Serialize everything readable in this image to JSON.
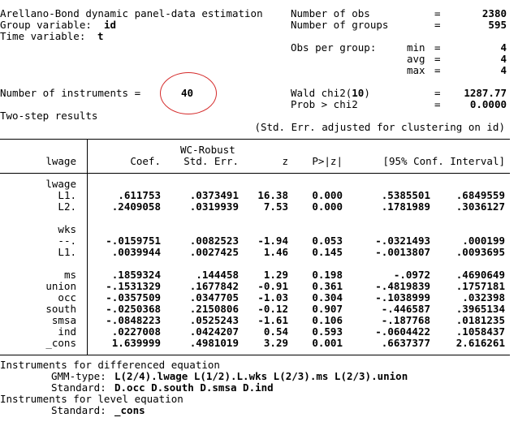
{
  "header": {
    "title": "Arellano-Bond dynamic panel-data estimation",
    "group_var_label": "Group variable:",
    "group_var": "id",
    "time_var_label": "Time variable:",
    "time_var": "t",
    "n_obs_label": "Number of obs",
    "n_obs": "2380",
    "n_groups_label": "Number of groups",
    "n_groups": "595",
    "obs_per_group_label": "Obs per group:",
    "min_label": "min",
    "min": "4",
    "avg_label": "avg",
    "avg": "4",
    "max_label": "max",
    "max": "4",
    "eq": "=",
    "n_instr_label": "Number of instruments =",
    "n_instr": "40",
    "wald_label": "Wald chi2(",
    "wald_df": "10",
    "wald_close": ")",
    "wald": "1287.77",
    "prob_label": "Prob > chi2",
    "prob": "0.0000",
    "two_step": "Two-step results",
    "se_note": "(Std. Err. adjusted for clustering on id)"
  },
  "table": {
    "dep_var": "lwage",
    "col_wc": "WC-Robust",
    "col_coef": "Coef.",
    "col_se": "Std. Err.",
    "col_z": "z",
    "col_p": "P>|z|",
    "col_ci": "[95% Conf. Interval]",
    "groups": {
      "lwage": "lwage",
      "wks": "wks"
    },
    "rows": [
      {
        "label": "L1.",
        "coef": ".611753",
        "se": ".0373491",
        "z": "16.38",
        "p": "0.000",
        "lo": ".5385501",
        "hi": ".6849559"
      },
      {
        "label": "L2.",
        "coef": ".2409058",
        "se": ".0319939",
        "z": "7.53",
        "p": "0.000",
        "lo": ".1781989",
        "hi": ".3036127"
      },
      {
        "label": "--.",
        "coef": "-.0159751",
        "se": ".0082523",
        "z": "-1.94",
        "p": "0.053",
        "lo": "-.0321493",
        "hi": ".000199"
      },
      {
        "label": "L1.",
        "coef": ".0039944",
        "se": ".0027425",
        "z": "1.46",
        "p": "0.145",
        "lo": "-.0013807",
        "hi": ".0093695"
      },
      {
        "label": "ms",
        "coef": ".1859324",
        "se": ".144458",
        "z": "1.29",
        "p": "0.198",
        "lo": "-.0972",
        "hi": ".4690649"
      },
      {
        "label": "union",
        "coef": "-.1531329",
        "se": ".1677842",
        "z": "-0.91",
        "p": "0.361",
        "lo": "-.4819839",
        "hi": ".1757181"
      },
      {
        "label": "occ",
        "coef": "-.0357509",
        "se": ".0347705",
        "z": "-1.03",
        "p": "0.304",
        "lo": "-.1038999",
        "hi": ".032398"
      },
      {
        "label": "south",
        "coef": "-.0250368",
        "se": ".2150806",
        "z": "-0.12",
        "p": "0.907",
        "lo": "-.446587",
        "hi": ".3965134"
      },
      {
        "label": "smsa",
        "coef": "-.0848223",
        "se": ".0525243",
        "z": "-1.61",
        "p": "0.106",
        "lo": "-.187768",
        "hi": ".0181235"
      },
      {
        "label": "ind",
        "coef": ".0227008",
        "se": ".0424207",
        "z": "0.54",
        "p": "0.593",
        "lo": "-.0604422",
        "hi": ".1058437"
      },
      {
        "label": "_cons",
        "coef": "1.639999",
        "se": ".4981019",
        "z": "3.29",
        "p": "0.001",
        "lo": ".6637377",
        "hi": "2.616261"
      }
    ]
  },
  "footer": {
    "diff_title": "Instruments for differenced equation",
    "gmm_label": "GMM-type:",
    "gmm": "L(2/4).lwage L(1/2).L.wks L(2/3).ms L(2/3).union",
    "std_label": "Standard:",
    "std_diff": "D.occ D.south D.smsa D.ind",
    "level_title": "Instruments for level equation",
    "std_level": "_cons"
  }
}
